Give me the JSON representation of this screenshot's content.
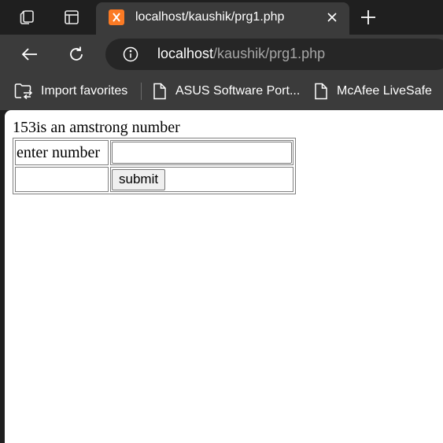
{
  "browser": {
    "tab": {
      "title": "localhost/kaushik/prg1.php"
    },
    "address": {
      "host": "localhost",
      "path": "/kaushik/prg1.php"
    },
    "favorites": [
      {
        "label": "Import favorites"
      },
      {
        "label": "ASUS Software Port..."
      },
      {
        "label": "McAfee LiveSafe"
      }
    ],
    "colors": {
      "tab_bg": "#3b3b3b",
      "strip_bg": "#1f1f1f",
      "favicon": "#fb7a24"
    }
  },
  "page": {
    "result_text": "153is an amstrong number",
    "form": {
      "label": "enter number",
      "input_value": "",
      "submit_label": "submit"
    }
  }
}
